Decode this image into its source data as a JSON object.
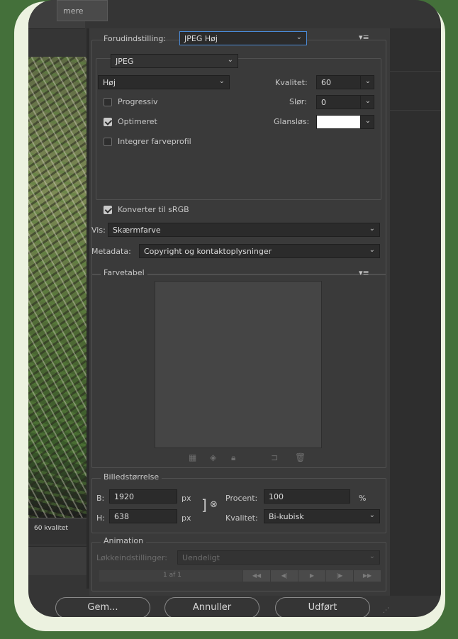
{
  "preview": {
    "tab_label": "mere",
    "quality_label": "60 kvalitet"
  },
  "preset": {
    "label": "Forudindstilling:",
    "value": "JPEG Høj",
    "menu_icon": "panel-menu-icon"
  },
  "format": {
    "value": "JPEG"
  },
  "quality_preset": {
    "value": "Høj"
  },
  "quality": {
    "label": "Kvalitet:",
    "value": "60"
  },
  "blur": {
    "label": "Slør:",
    "value": "0"
  },
  "matte": {
    "label": "Glansløs:",
    "color": "#ffffff"
  },
  "options": {
    "progressive": {
      "label": "Progressiv",
      "checked": false
    },
    "optimized": {
      "label": "Optimeret",
      "checked": true
    },
    "embed_profile": {
      "label": "Integrer farveprofil",
      "checked": false
    },
    "convert_srgb": {
      "label": "Konverter til sRGB",
      "checked": true
    }
  },
  "preview_mode": {
    "label": "Vis:",
    "value": "Skærmfarve"
  },
  "metadata": {
    "label": "Metadata:",
    "value": "Copyright og kontaktoplysninger"
  },
  "color_table": {
    "title": "Farvetabel",
    "tools": [
      "map-transparent-icon",
      "web-snap-icon",
      "lock-color-icon",
      "new-color-icon",
      "delete-color-icon"
    ]
  },
  "image_size": {
    "title": "Billedstørrelse",
    "width_label": "B:",
    "width_value": "1920",
    "height_label": "H:",
    "height_value": "638",
    "unit": "px",
    "percent_label": "Procent:",
    "percent_value": "100",
    "percent_unit": "%",
    "quality_label": "Kvalitet:",
    "quality_value": "Bi-kubisk"
  },
  "animation": {
    "title": "Animation",
    "loop_label": "Løkkeindstillinger:",
    "loop_value": "Uendeligt",
    "frame_counter": "1 af 1"
  },
  "buttons": {
    "save": "Gem...",
    "cancel": "Annuller",
    "done": "Udført"
  }
}
